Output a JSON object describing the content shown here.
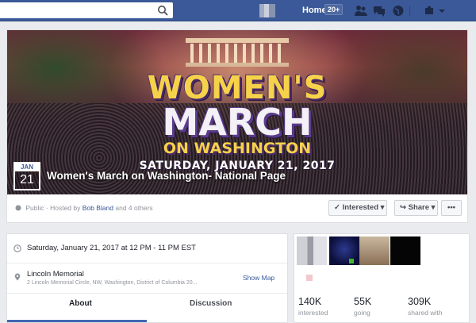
{
  "topbar": {
    "search_placeholder": "",
    "home_label": "Home",
    "home_count": "20+",
    "icons": [
      "search-icon",
      "friends-icon",
      "messages-icon",
      "globe-icon",
      "settings-icon",
      "chevron-down-icon"
    ]
  },
  "cover": {
    "poster_line1": "WOMEN'S",
    "poster_line2": "MARCH",
    "poster_line3": "ON WASHINGTON",
    "poster_line4": "SATURDAY, JANUARY 21, 2017",
    "date_month": "JAN",
    "date_day": "21",
    "event_title": "Women's March on Washington- National Page"
  },
  "meta": {
    "privacy": "Public",
    "hosted_prefix": "· Hosted by",
    "host": "Bob Bland",
    "others": "and 4 others"
  },
  "actions": {
    "interested_label": "Interested",
    "share_label": "Share",
    "more_label": "•••"
  },
  "details": {
    "time": "Saturday, January 21, 2017 at 12 PM - 11 PM EST",
    "location_name": "Lincoln Memorial",
    "location_address": "2 Lincoln Memorial Circle, NW, Washington, District of Columbia 20...",
    "show_map_label": "Show Map",
    "tabs": [
      {
        "label": "About"
      },
      {
        "label": "Discussion"
      }
    ]
  },
  "stats": [
    {
      "value": "140K",
      "label": "interested"
    },
    {
      "value": "55K",
      "label": "going"
    },
    {
      "value": "309K",
      "label": "shared with"
    }
  ],
  "colors": {
    "brand": "#3b5998",
    "link": "#365899",
    "accent": "#4267b2",
    "poster_yellow": "#f6d24a"
  }
}
